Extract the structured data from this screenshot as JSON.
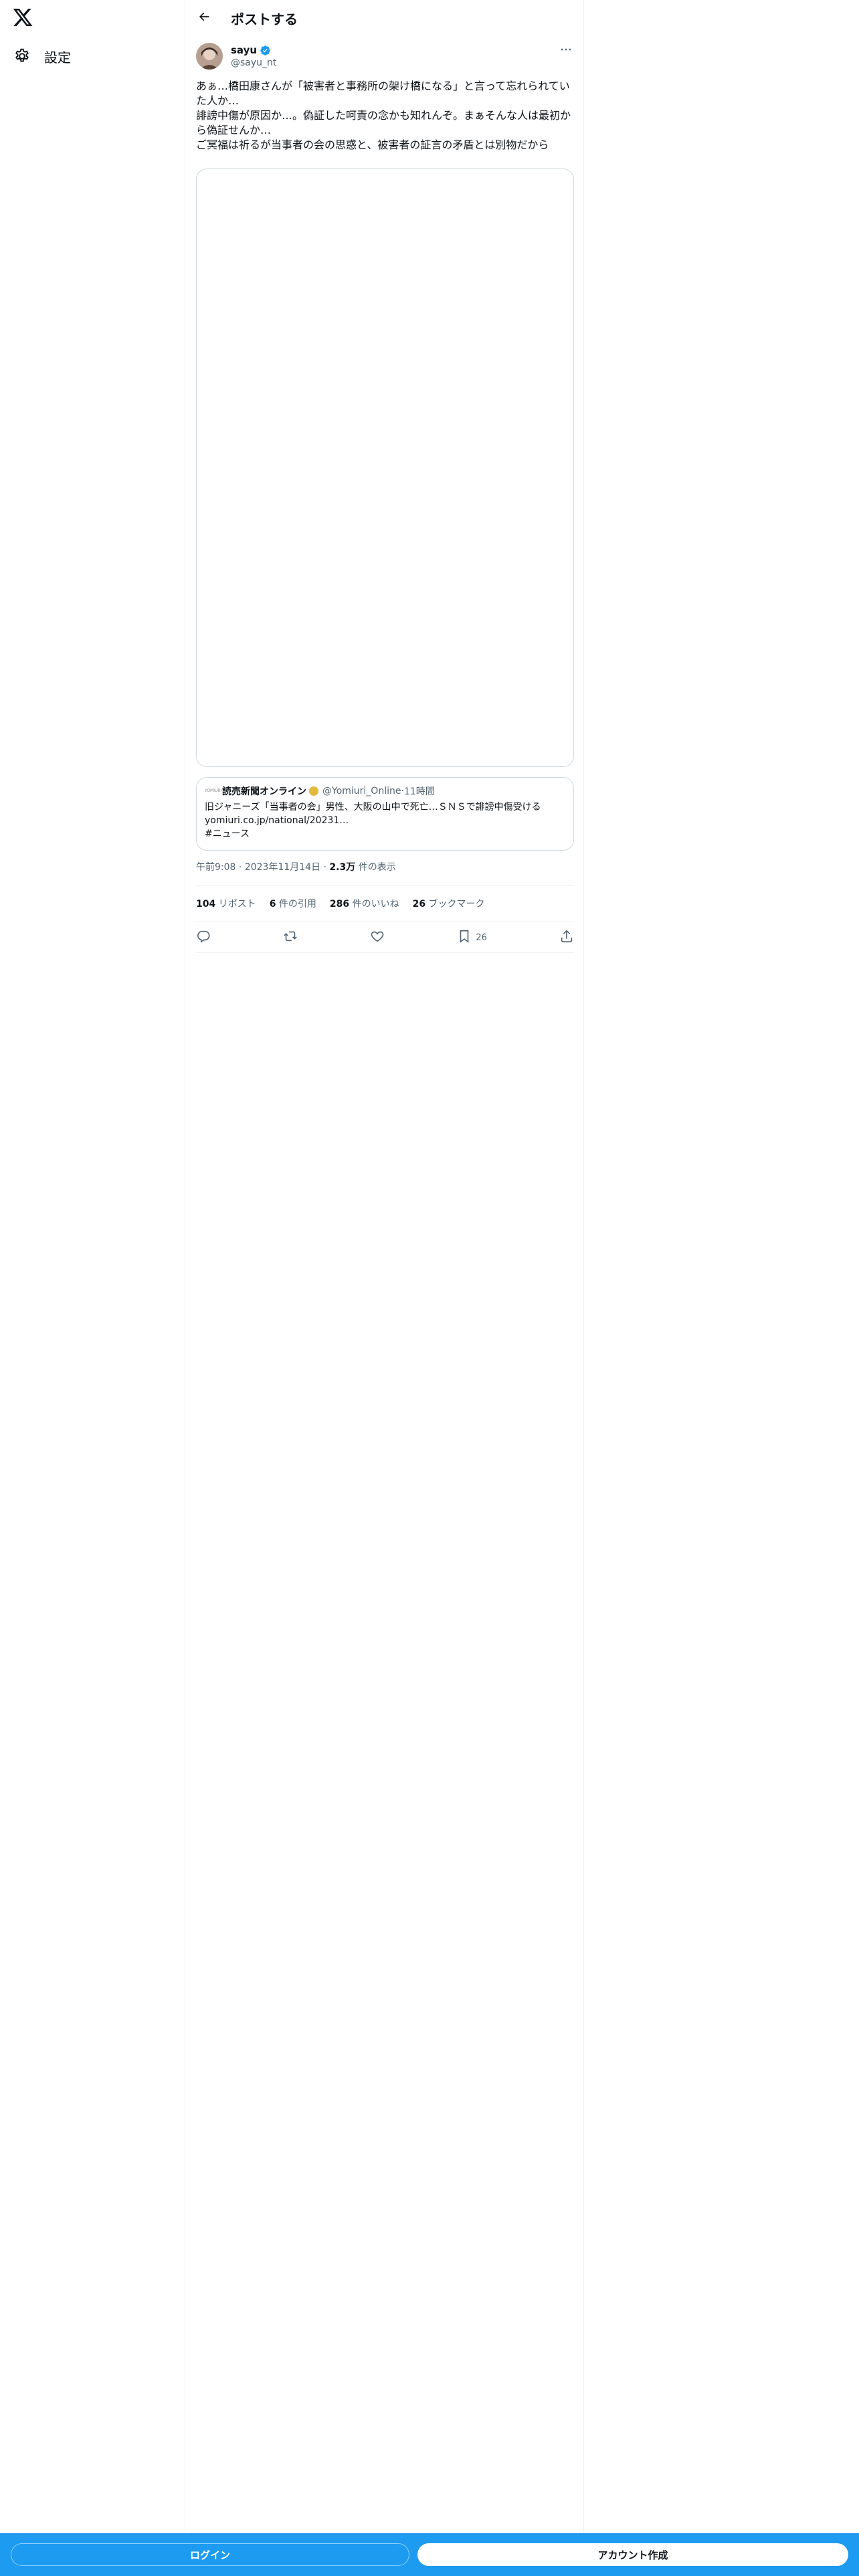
{
  "sidebar": {
    "logo_icon": "x-logo-icon",
    "settings": {
      "icon": "gear-icon",
      "label": "設定"
    }
  },
  "header": {
    "back_icon": "arrow-left-icon",
    "title": "ポストする"
  },
  "post": {
    "author": {
      "name": "sayu",
      "handle": "@sayu_nt",
      "verified": true
    },
    "text_lines": [
      "あぁ…橋田康さんが「被害者と事務所の架け橋になる」と言って忘れられていた人か…",
      "誹謗中傷が原因か…。偽証した呵責の念かも知れんぞ。まぁそんな人は最初から偽証せんか…",
      "ご冥福は祈るが当事者の会の思惑と、被害者の証言の矛盾とは別物だから"
    ],
    "quote": {
      "name": "読売新聞オンライン",
      "handle": "@Yomiuri_Online",
      "separator": " · ",
      "time": "11時間",
      "lines": [
        "旧ジャニーズ「当事者の会」男性、大阪の山中で死亡…ＳＮＳで誹謗中傷受ける",
        "yomiuri.co.jp/national/20231…",
        "#ニュース"
      ]
    },
    "meta": {
      "time": "午前9:08",
      "date": "2023年11月14日",
      "views_value": "2.3万",
      "views_label": " 件の表示"
    },
    "stats": {
      "reposts_value": "104",
      "reposts_label": " リポスト",
      "quotes_value": "6",
      "quotes_label": " 件の引用",
      "likes_value": "286",
      "likes_label": " 件のいいね",
      "bookmarks_value": "26",
      "bookmarks_label": " ブックマーク"
    },
    "actions": {
      "bookmark_count": "26"
    }
  },
  "bottom_bar": {
    "login_label": "ログイン",
    "signup_label": "アカウント作成"
  },
  "colors": {
    "accent": "#1d9bf0",
    "text": "#0f1419",
    "secondary_text": "#536471",
    "border": "#cfd9de"
  }
}
